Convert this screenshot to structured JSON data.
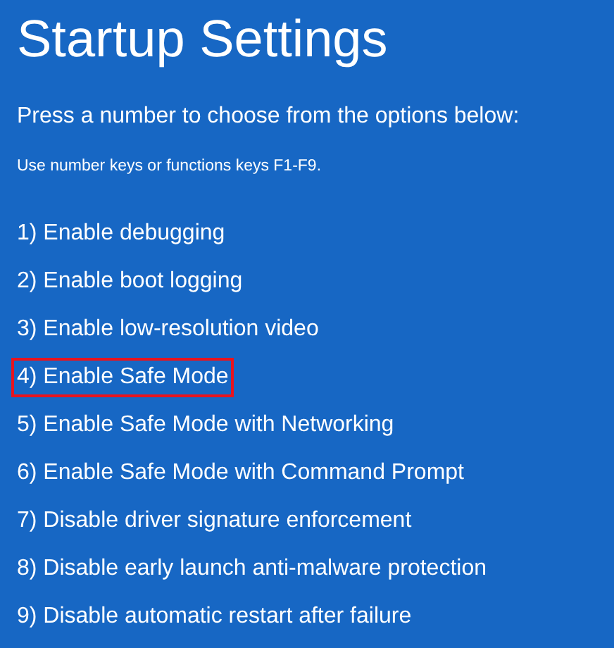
{
  "title": "Startup Settings",
  "prompt": "Press a number to choose from the options below:",
  "hint": "Use number keys or functions keys F1-F9.",
  "options": [
    {
      "label": "1) Enable debugging",
      "selected": false
    },
    {
      "label": "2) Enable boot logging",
      "selected": false
    },
    {
      "label": "3) Enable low-resolution video",
      "selected": false
    },
    {
      "label": "4) Enable Safe Mode",
      "selected": true
    },
    {
      "label": "5) Enable Safe Mode with Networking",
      "selected": false
    },
    {
      "label": "6) Enable Safe Mode with Command Prompt",
      "selected": false
    },
    {
      "label": "7) Disable driver signature enforcement",
      "selected": false
    },
    {
      "label": "8) Disable early launch anti-malware protection",
      "selected": false
    },
    {
      "label": "9) Disable automatic restart after failure",
      "selected": false
    }
  ]
}
